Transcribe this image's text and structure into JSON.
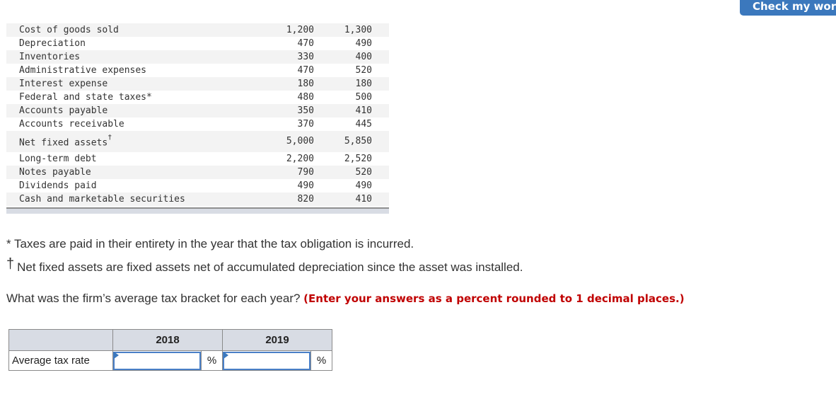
{
  "header": {
    "check_button_label": "Check my work"
  },
  "financial_table": {
    "rows": [
      {
        "label": "Cost of goods sold",
        "y2018": "1,200",
        "y2019": "1,300"
      },
      {
        "label": "Depreciation",
        "y2018": "470",
        "y2019": "490"
      },
      {
        "label": "Inventories",
        "y2018": "330",
        "y2019": "400"
      },
      {
        "label": "Administrative expenses",
        "y2018": "470",
        "y2019": "520"
      },
      {
        "label": "Interest expense",
        "y2018": "180",
        "y2019": "180"
      },
      {
        "label": "Federal and state taxes*",
        "y2018": "480",
        "y2019": "500"
      },
      {
        "label": "Accounts payable",
        "y2018": "350",
        "y2019": "410"
      },
      {
        "label": "Accounts receivable",
        "y2018": "370",
        "y2019": "445"
      },
      {
        "label": "Net fixed assets",
        "sup": "†",
        "y2018": "5,000",
        "y2019": "5,850"
      },
      {
        "label": "Long-term debt",
        "y2018": "2,200",
        "y2019": "2,520"
      },
      {
        "label": "Notes payable",
        "y2018": "790",
        "y2019": "520"
      },
      {
        "label": "Dividends paid",
        "y2018": "490",
        "y2019": "490"
      },
      {
        "label": "Cash and marketable securities",
        "y2018": "820",
        "y2019": "410"
      }
    ]
  },
  "footnotes": {
    "taxes": "* Taxes are paid in their entirety in the year that the tax obligation is incurred.",
    "dagger_symbol": "†",
    "net_fixed_assets": "Net fixed assets are fixed assets net of accumulated depreciation since the asset was installed."
  },
  "question": {
    "text": "What was the firm’s average tax bracket for each year?",
    "instruction": "(Enter your answers as a percent rounded to 1 decimal places.)"
  },
  "answer_table": {
    "headers": [
      "",
      "2018",
      "2019"
    ],
    "row_label": "Average tax rate",
    "input_2018_value": "",
    "input_2019_value": "",
    "unit": "%"
  }
}
